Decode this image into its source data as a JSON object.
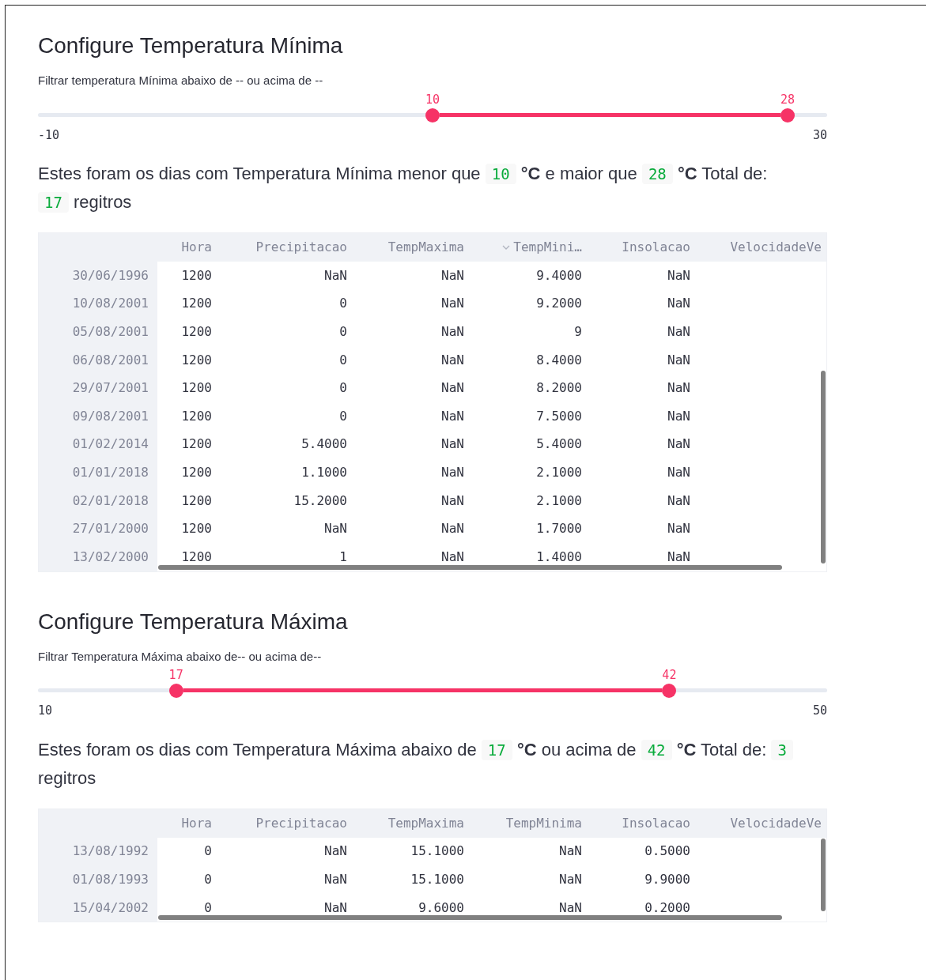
{
  "sections": [
    {
      "title": "Configure Temperatura Mínima",
      "slider": {
        "label": "Filtrar temperatura Mínima abaixo de -- ou acima de --",
        "min": "-10",
        "max": "30",
        "handles": [
          {
            "value": "10",
            "level": 0.5
          },
          {
            "value": "28",
            "level": 0.95
          }
        ]
      },
      "sentence": [
        {
          "kind": "text",
          "text": "Estes foram os dias com Temperatura Mínima menor que"
        },
        {
          "kind": "code",
          "text": "10"
        },
        {
          "kind": "unit",
          "text": "°C"
        },
        {
          "kind": "text",
          "text": "e maior que"
        },
        {
          "kind": "code",
          "text": "28"
        },
        {
          "kind": "unit",
          "text": "°C"
        },
        {
          "kind": "text",
          "text": "Total de:"
        },
        {
          "kind": "code",
          "text": "17"
        },
        {
          "kind": "text",
          "text": "regitros"
        }
      ],
      "table": {
        "columns": [
          {
            "label": "Hora",
            "sorted": false
          },
          {
            "label": "Precipitacao",
            "sorted": false
          },
          {
            "label": "TempMaxima",
            "sorted": false
          },
          {
            "label": "TempMini…",
            "sorted": true
          },
          {
            "label": "Insolacao",
            "sorted": false
          },
          {
            "label": "VelocidadeVe",
            "sorted": false
          }
        ],
        "rows": [
          {
            "index": "30/06/1996",
            "cells": [
              "1200",
              "NaN",
              "NaN",
              "9.4000",
              "NaN"
            ]
          },
          {
            "index": "10/08/2001",
            "cells": [
              "1200",
              "0",
              "NaN",
              "9.2000",
              "NaN"
            ]
          },
          {
            "index": "05/08/2001",
            "cells": [
              "1200",
              "0",
              "NaN",
              "9",
              "NaN"
            ]
          },
          {
            "index": "06/08/2001",
            "cells": [
              "1200",
              "0",
              "NaN",
              "8.4000",
              "NaN"
            ]
          },
          {
            "index": "29/07/2001",
            "cells": [
              "1200",
              "0",
              "NaN",
              "8.2000",
              "NaN"
            ]
          },
          {
            "index": "09/08/2001",
            "cells": [
              "1200",
              "0",
              "NaN",
              "7.5000",
              "NaN"
            ]
          },
          {
            "index": "01/02/2014",
            "cells": [
              "1200",
              "5.4000",
              "NaN",
              "5.4000",
              "NaN"
            ]
          },
          {
            "index": "01/01/2018",
            "cells": [
              "1200",
              "1.1000",
              "NaN",
              "2.1000",
              "NaN"
            ]
          },
          {
            "index": "02/01/2018",
            "cells": [
              "1200",
              "15.2000",
              "NaN",
              "2.1000",
              "NaN"
            ]
          },
          {
            "index": "27/01/2000",
            "cells": [
              "1200",
              "NaN",
              "NaN",
              "1.7000",
              "NaN"
            ]
          },
          {
            "index": "13/02/2000",
            "cells": [
              "1200",
              "1",
              "NaN",
              "1.4000",
              "NaN"
            ]
          }
        ]
      }
    },
    {
      "title": "Configure Temperatura Máxima",
      "slider": {
        "label": "Filtrar Temperatura Máxima abaixo de-- ou acima de--",
        "min": "10",
        "max": "50",
        "handles": [
          {
            "value": "17",
            "level": 0.175
          },
          {
            "value": "42",
            "level": 0.8
          }
        ]
      },
      "sentence": [
        {
          "kind": "text",
          "text": "Estes foram os dias com Temperatura Máxima abaixo de"
        },
        {
          "kind": "code",
          "text": "17"
        },
        {
          "kind": "unit",
          "text": "°C"
        },
        {
          "kind": "text",
          "text": "ou acima de"
        },
        {
          "kind": "code",
          "text": "42"
        },
        {
          "kind": "unit",
          "text": "°C"
        },
        {
          "kind": "text",
          "text": "Total de:"
        },
        {
          "kind": "code",
          "text": "3"
        },
        {
          "kind": "text",
          "text": "regitros"
        }
      ],
      "table": {
        "columns": [
          {
            "label": "Hora",
            "sorted": false
          },
          {
            "label": "Precipitacao",
            "sorted": false
          },
          {
            "label": "TempMaxima",
            "sorted": false
          },
          {
            "label": "TempMinima",
            "sorted": false
          },
          {
            "label": "Insolacao",
            "sorted": false
          },
          {
            "label": "VelocidadeVe",
            "sorted": false
          }
        ],
        "rows": [
          {
            "index": "13/08/1992",
            "cells": [
              "0",
              "NaN",
              "15.1000",
              "NaN",
              "0.5000"
            ]
          },
          {
            "index": "01/08/1993",
            "cells": [
              "0",
              "NaN",
              "15.1000",
              "NaN",
              "9.9000"
            ]
          },
          {
            "index": "15/04/2002",
            "cells": [
              "0",
              "NaN",
              "9.6000",
              "NaN",
              "0.2000"
            ]
          }
        ]
      }
    }
  ]
}
